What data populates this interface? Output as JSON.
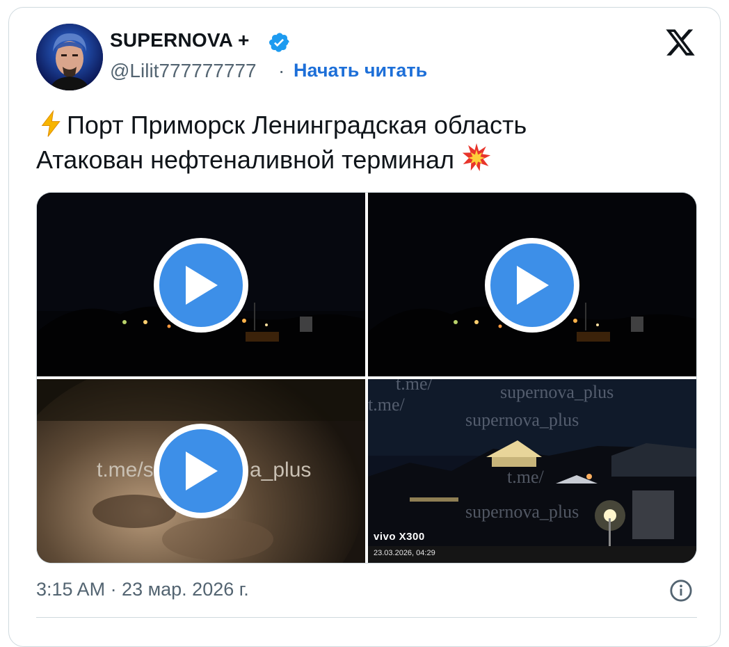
{
  "author": {
    "name": "SUPERNOVA +",
    "handle": "@Lilit777777777",
    "separator": "·",
    "follow_label": "Начать читать"
  },
  "tweet": {
    "line1": "Порт Приморск  Ленинградская область",
    "line2": "Атакован нефтеналивной терминал"
  },
  "media": {
    "watermark_tile3": "t.me/s",
    "watermark_tile3_tail": "a_plus",
    "watermark_tile4": [
      "t.me/",
      "supernova_plus",
      "t.me/",
      "supernova_plus",
      "t.me/",
      "supernova_plus"
    ],
    "camera_model": "vivo X300",
    "camera_timestamp": "23.03.2026, 04:29"
  },
  "footer": {
    "timestamp": "3:15 AM · 23 мар. 2026 г."
  },
  "colors": {
    "accent": "#1d9bf0",
    "follow": "#1d6fd8",
    "play": "#3d8fe8",
    "text": "#0f1419",
    "muted": "#536471"
  },
  "icons": [
    "verified-badge-icon",
    "x-logo-icon",
    "lightning-icon",
    "collision-icon",
    "play-icon",
    "info-icon"
  ]
}
